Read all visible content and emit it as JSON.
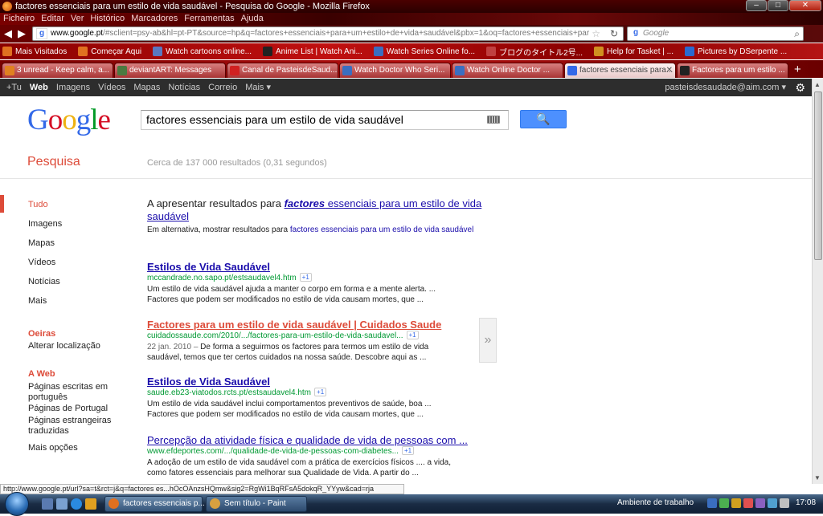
{
  "window": {
    "title": "factores essenciais para um estilo de vida saudável - Pesquisa do Google - Mozilla Firefox",
    "buttons": {
      "minimize": "–",
      "maximize": "□",
      "close": "✕"
    }
  },
  "menu": [
    "Ficheiro",
    "Editar",
    "Ver",
    "Histórico",
    "Marcadores",
    "Ferramentas",
    "Ajuda"
  ],
  "nav": {
    "back": "◀",
    "forward": "▶",
    "url_domain": "www.google.pt",
    "url_rest": "/#sclient=psy-ab&hl=pt-PT&source=hp&q=factores+essenciais+para+um+estilo+de+vida+saudável&pbx=1&oq=factores+essenciais+par",
    "search_placeholder": "Google"
  },
  "bookmarks": [
    {
      "label": "Mais Visitados",
      "color": "#e07020"
    },
    {
      "label": "Começar Aqui",
      "color": "#e07020"
    },
    {
      "label": "Watch cartoons online...",
      "color": "#5a78c0"
    },
    {
      "label": "Anime List | Watch Ani...",
      "color": "#222222"
    },
    {
      "label": "Watch Series Online fo...",
      "color": "#3a6ec0"
    },
    {
      "label": "ブログのタイトル2号...",
      "color": "#c04040"
    },
    {
      "label": "Help for Tasket | ...",
      "color": "#d09020"
    },
    {
      "label": "Pictures by DSerpente ...",
      "color": "#2a6ad0"
    }
  ],
  "tabs": [
    {
      "label": "3 unread - Keep calm, a...",
      "color": "#e08020",
      "active": false
    },
    {
      "label": "deviantART: Messages",
      "color": "#4a7a40",
      "active": false
    },
    {
      "label": "Canal de PasteisdeSaud...",
      "color": "#d02020",
      "active": false
    },
    {
      "label": "Watch Doctor Who Seri...",
      "color": "#3a6ec0",
      "active": false
    },
    {
      "label": "Watch Online Doctor ...",
      "color": "#3a6ec0",
      "active": false
    },
    {
      "label": "factores essenciais para...",
      "color": "#3369e8",
      "active": true
    },
    {
      "label": "Factores para um estilo ...",
      "color": "#222222",
      "active": false
    }
  ],
  "gbar": {
    "links": [
      "+Tu",
      "Web",
      "Imagens",
      "Vídeos",
      "Mapas",
      "Notícias",
      "Correio",
      "Mais ▾"
    ],
    "account": "pasteisdesaudade@aim.com ▾",
    "gear": "⚙"
  },
  "search": {
    "query": "factores essenciais para um estilo de vida saudável",
    "button_icon": "🔍",
    "section": "Pesquisa",
    "stats": "Cerca de 137 000 resultados (0,31 segundos)"
  },
  "leftnav": {
    "types": [
      "Tudo",
      "Imagens",
      "Mapas",
      "Vídeos",
      "Notícias",
      "Mais"
    ],
    "location_head": "Oeiras",
    "location_change": "Alterar localização",
    "web_head": "A Web",
    "web_options": [
      "Páginas escritas em português",
      "Páginas de Portugal",
      "Páginas estrangeiras traduzidas"
    ],
    "more_options": "Mais opções"
  },
  "spelling": {
    "prefix": "A apresentar resultados para ",
    "link_bold": "factores",
    "link_rest": " essenciais para um estilo de vida saudável",
    "alt_prefix": "Em alternativa, mostrar resultados para ",
    "alt_link": "factores essenciais para um estilo de vida saudável"
  },
  "results": [
    {
      "title": "Estilos de Vida Saudável",
      "url": "mccandrade.no.sapo.pt/estsaudavel4.htm",
      "snippet_line1": "Um estilo de vida saudável ajuda a manter o corpo em forma e a mente alerta. ...",
      "snippet_line2": "Factores que podem ser modificados no estilo de vida causam mortes, que ..."
    },
    {
      "title": "Factores para um estilo de vida saudável | Cuidados Saude",
      "url": "cuidadossaude.com/2010/.../factores-para-um-estilo-de-vida-saudavel...",
      "date": "22 jan. 2010 –",
      "snippet_line1": "De forma a seguirmos os factores para termos um estilo de vida",
      "snippet_line2": "saudável, temos que ter certos cuidados na nossa saúde. Descobre aqui as ..."
    },
    {
      "title": "Estilos de Vida Saudável",
      "url": "saude.eb23-viatodos.rcts.pt/estsaudavel4.htm",
      "snippet_line1": "Um estilo de vida saudável inclui comportamentos preventivos de saúde, boa ...",
      "snippet_line2": "Factores que podem ser modificados no estilo de vida causam mortes, que ..."
    },
    {
      "title": "Percepção da atividade física e qualidade de vida de pessoas com ...",
      "url": "www.efdeportes.com/.../qualidade-de-vida-de-pessoas-com-diabetes...",
      "snippet_line1": "A adoção de um estilo de vida saudável com a prática de exercícios físicos .... a vida,",
      "snippet_line2": "como fatores essenciais para melhorar sua Qualidade de Vida. A partir do ..."
    }
  ],
  "plus_one": "+1",
  "preview_arrow": "»",
  "status_url": "http://www.google.pt/url?sa=t&rct=j&q=factores es...hOcOAnzsHQmw&sig2=RgWi1BqRFsA5dokqR_YYyw&cad=rja",
  "taskbar": {
    "items": [
      {
        "label": "factores essenciais p...",
        "color": "#e07020"
      },
      {
        "label": "Sem título - Paint",
        "color": "#d8a040"
      }
    ],
    "desktop_label": "Ambiente de trabalho",
    "clock": "17:08"
  }
}
